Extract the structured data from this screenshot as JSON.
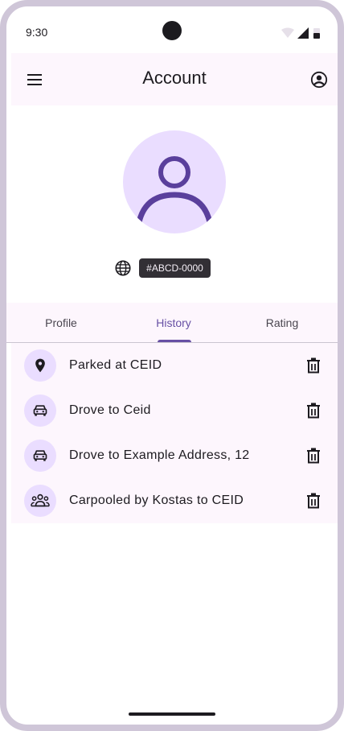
{
  "status_bar": {
    "time": "9:30"
  },
  "app_bar": {
    "title": "Account"
  },
  "profile": {
    "user_id": "#ABCD-0000"
  },
  "tabs": [
    {
      "label": "Profile",
      "selected": false
    },
    {
      "label": "History",
      "selected": true
    },
    {
      "label": "Rating",
      "selected": false
    }
  ],
  "history": [
    {
      "icon": "location-pin-icon",
      "text": "Parked at CEID"
    },
    {
      "icon": "car-icon",
      "text": "Drove to Ceid"
    },
    {
      "icon": "car-icon",
      "text": "Drove to Example Address, 12"
    },
    {
      "icon": "group-icon",
      "text": "Carpooled by Kostas to CEID"
    }
  ],
  "colors": {
    "primary": "#6750a4",
    "surface_container": "#fdf6fd",
    "avatar_bg": "#eaddff",
    "avatar_fg": "#5a3f9c",
    "chip_bg": "#322f35",
    "frame": "#cfc6d8"
  }
}
